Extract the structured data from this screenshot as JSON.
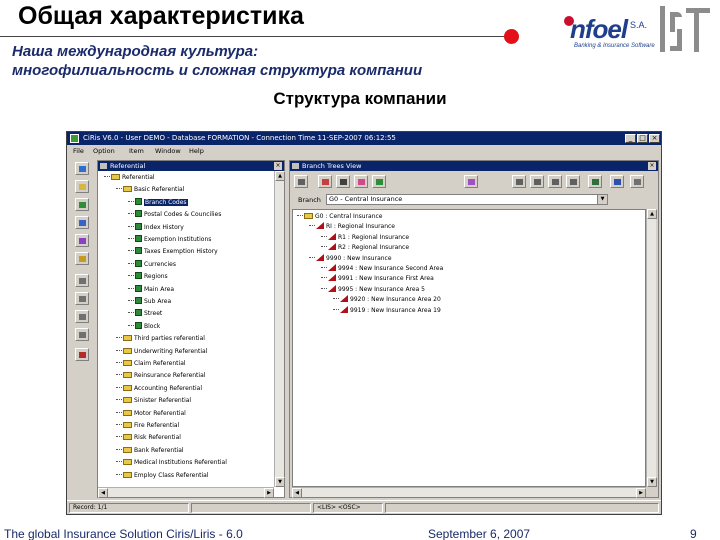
{
  "slide": {
    "title": "Общая характеристика",
    "subtitle_line1": "Наша международная культура:",
    "subtitle_line2": "многофилиальность и сложная структура компании",
    "section_title": "Структура компании",
    "logo_brand": "nfoel",
    "logo_sa": "S.A.",
    "logo_tagline": "Banking & Insurance Software"
  },
  "app": {
    "window_title": "CiRis V6.0 - User DEMO - Database FORMATION - Connection Time 11-SEP-2007 06:12:55",
    "menu": [
      "File",
      "Option",
      "Item",
      "Window",
      "Help"
    ],
    "left_panel_title": "Referential",
    "right_panel_title": "Branch Trees View",
    "branch_label": "Branch",
    "branch_value": "G0 - Central Insurance",
    "left_tree": [
      {
        "label": "Referential",
        "icon": "folder"
      },
      {
        "label": "Basic Referential",
        "icon": "folder"
      },
      {
        "label": "Branch Codes",
        "icon": "table",
        "selected": true
      },
      {
        "label": "Postal Codes & Councilies",
        "icon": "table"
      },
      {
        "label": "Index History",
        "icon": "table"
      },
      {
        "label": "Exemption Institutions",
        "icon": "table"
      },
      {
        "label": "Taxes Exemption History",
        "icon": "table"
      },
      {
        "label": "Currencies",
        "icon": "table"
      },
      {
        "label": "Regions",
        "icon": "table"
      },
      {
        "label": "Main Area",
        "icon": "table"
      },
      {
        "label": "Sub Area",
        "icon": "table"
      },
      {
        "label": "Street",
        "icon": "table"
      },
      {
        "label": "Block",
        "icon": "table"
      },
      {
        "label": "Third parties referential",
        "icon": "folder"
      },
      {
        "label": "Underwriting Referential",
        "icon": "folder"
      },
      {
        "label": "Claim Referential",
        "icon": "folder"
      },
      {
        "label": "Reinsurance Referential",
        "icon": "folder"
      },
      {
        "label": "Accounting Referential",
        "icon": "folder"
      },
      {
        "label": "Sinister Referential",
        "icon": "folder"
      },
      {
        "label": "Motor Referential",
        "icon": "folder"
      },
      {
        "label": "Fire Referential",
        "icon": "folder"
      },
      {
        "label": "Risk Referential",
        "icon": "folder"
      },
      {
        "label": "Bank Referential",
        "icon": "folder"
      },
      {
        "label": "Medical Institutions Referential",
        "icon": "folder"
      },
      {
        "label": "Employ Class Referential",
        "icon": "folder"
      }
    ],
    "right_tree": [
      {
        "label": "G0 : Central Insurance",
        "icon": "folder"
      },
      {
        "label": "RI : Regional Insurance",
        "icon": "triangle"
      },
      {
        "label": "R1 : Regional Insurance",
        "icon": "triangle"
      },
      {
        "label": "R2 : Regional Insurance",
        "icon": "triangle"
      },
      {
        "label": "9990 : New Insurance",
        "icon": "triangle"
      },
      {
        "label": "9994 : New Insurance Second Area",
        "icon": "triangle"
      },
      {
        "label": "9991 : New Insurance First Area",
        "icon": "triangle"
      },
      {
        "label": "9995 : New Insurance Area 5",
        "icon": "triangle"
      },
      {
        "label": "9920 : New Insurance Area 20",
        "icon": "triangle"
      },
      {
        "label": "9919 : New Insurance Area 19",
        "icon": "triangle"
      }
    ],
    "status_left": "Record: 1/1",
    "status_mid": "<LIS> <OSC>"
  },
  "footer": {
    "left": "The global Insurance Solution  Ciris/Liris - 6.0",
    "center": "September 6, 2007",
    "page": "9"
  },
  "colors": {
    "title_bar": "#0a246a",
    "window_chrome": "#d4d0c8",
    "accent_red": "#e3101a",
    "text_navy": "#1a2a6a",
    "logo_blue": "#1f3f8c"
  }
}
